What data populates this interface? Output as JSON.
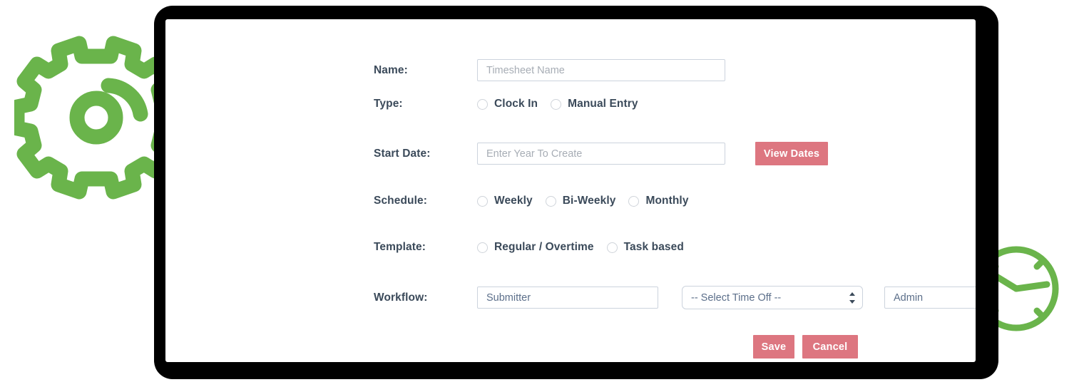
{
  "decor": {
    "gear_icon": "gear-icon",
    "clock_icon": "clock-icon",
    "accent_green": "#6ab44b",
    "frame_color": "#000000"
  },
  "theme": {
    "button_color": "#dd7680",
    "label_color": "#3b4a5a",
    "input_text_color": "#5c6f8a",
    "placeholder_color": "#a7adb5",
    "input_border_color": "#ccd3dd"
  },
  "form": {
    "name": {
      "label": "Name:",
      "placeholder": "Timesheet Name",
      "value": ""
    },
    "type": {
      "label": "Type:",
      "options": [
        {
          "label": "Clock In",
          "selected": false
        },
        {
          "label": "Manual Entry",
          "selected": false
        }
      ]
    },
    "start_date": {
      "label": "Start Date:",
      "placeholder": "Enter Year To Create",
      "value": "",
      "button_label": "View Dates"
    },
    "schedule": {
      "label": "Schedule:",
      "options": [
        {
          "label": "Weekly",
          "selected": false
        },
        {
          "label": "Bi-Weekly",
          "selected": false
        },
        {
          "label": "Monthly",
          "selected": false
        }
      ]
    },
    "template": {
      "label": "Template:",
      "options": [
        {
          "label": "Regular / Overtime",
          "selected": false
        },
        {
          "label": "Task based",
          "selected": false
        }
      ]
    },
    "workflow": {
      "label": "Workflow:",
      "submitter_value": "Submitter",
      "submitter_placeholder": "Submitter",
      "time_off_selected": "-- Select Time Off --",
      "approver_value": "Admin",
      "approver_placeholder": "Admin"
    }
  },
  "actions": {
    "save_label": "Save",
    "cancel_label": "Cancel"
  }
}
